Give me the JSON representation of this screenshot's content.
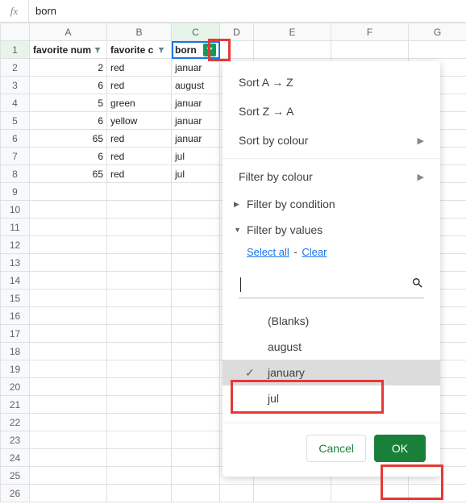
{
  "formula_bar": {
    "fx_label": "fx",
    "value": "born"
  },
  "columns": [
    "A",
    "B",
    "C",
    "D",
    "E",
    "F",
    "G"
  ],
  "row_numbers": [
    1,
    2,
    3,
    4,
    5,
    6,
    7,
    8,
    9,
    10,
    11,
    12,
    13,
    14,
    15,
    16,
    17,
    18,
    19,
    20,
    21,
    22,
    23,
    24,
    25,
    26
  ],
  "headers": {
    "A": "favorite num",
    "B": "favorite c",
    "C": "born"
  },
  "rows": [
    {
      "A": "2",
      "B": "red",
      "C": "januar"
    },
    {
      "A": "6",
      "B": "red",
      "C": "august"
    },
    {
      "A": "5",
      "B": "green",
      "C": "januar"
    },
    {
      "A": "6",
      "B": "yellow",
      "C": "januar"
    },
    {
      "A": "65",
      "B": "red",
      "C": "januar"
    },
    {
      "A": "6",
      "B": "red",
      "C": "jul"
    },
    {
      "A": "65",
      "B": "red",
      "C": "jul"
    }
  ],
  "filter_menu": {
    "sort_az": "Sort A → Z",
    "sort_za": "Sort Z → A",
    "sort_by_colour": "Sort by colour",
    "filter_by_colour": "Filter by colour",
    "filter_by_condition": "Filter by condition",
    "filter_by_values": "Filter by values",
    "select_all": "Select all",
    "clear": "Clear",
    "search_placeholder": "",
    "values": [
      {
        "label": "(Blanks)",
        "selected": false
      },
      {
        "label": "august",
        "selected": false
      },
      {
        "label": "january",
        "selected": true
      },
      {
        "label": "jul",
        "selected": false
      }
    ],
    "cancel": "Cancel",
    "ok": "OK"
  }
}
